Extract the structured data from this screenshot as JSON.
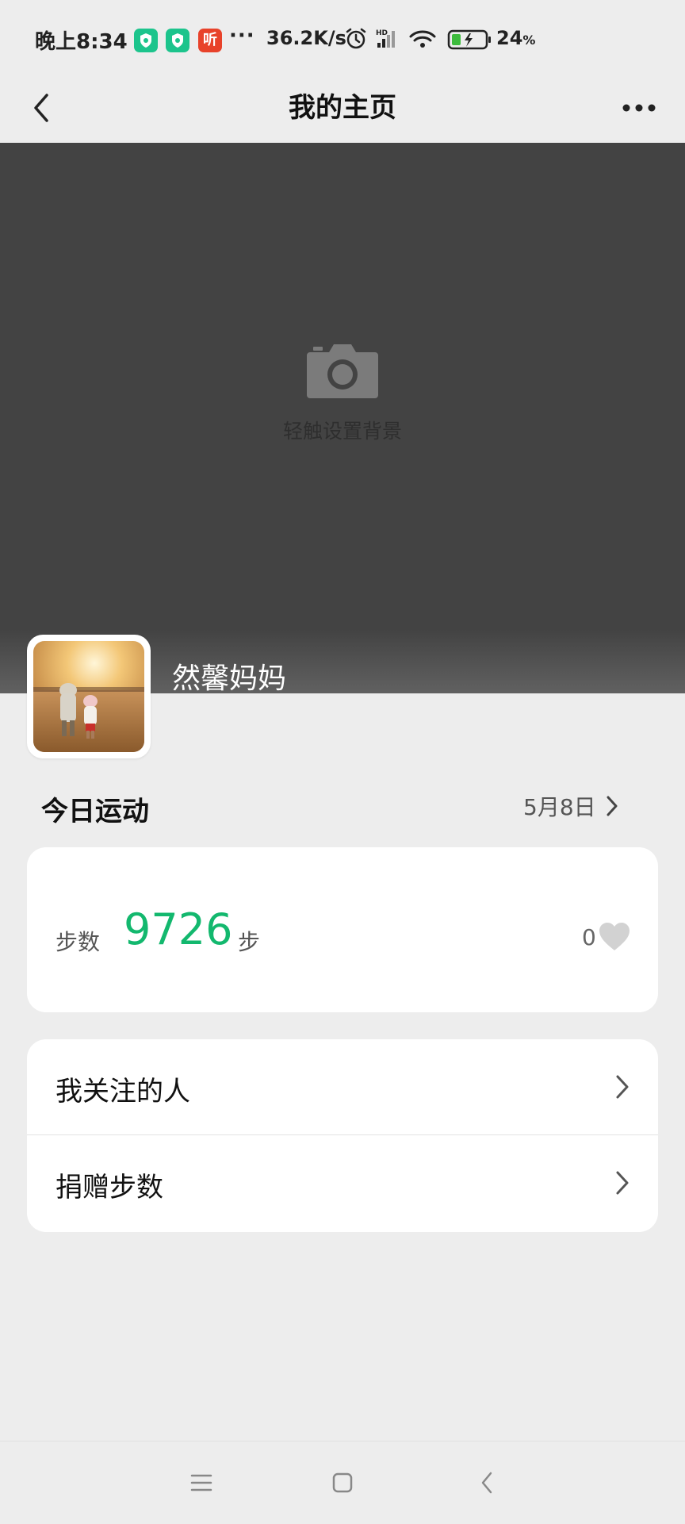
{
  "status_bar": {
    "time": "晚上8:34",
    "badge3_text": "听",
    "more": "···",
    "net_speed": "36.2K/s",
    "hd_label": "HD",
    "battery_percent": "24",
    "battery_unit": "%"
  },
  "nav": {
    "title": "我的主页"
  },
  "cover": {
    "set_background_label": "轻触设置背景"
  },
  "profile": {
    "nickname": "然馨妈妈"
  },
  "today": {
    "title": "今日运动",
    "date": "5月8日"
  },
  "steps": {
    "label": "步数",
    "value": "9726",
    "unit": "步",
    "likes": "0"
  },
  "menu": {
    "items": [
      {
        "label": "我关注的人"
      },
      {
        "label": "捐赠步数"
      }
    ]
  },
  "colors": {
    "accent_green": "#13b86e",
    "cover_bg": "#434343",
    "page_bg": "#ededed"
  },
  "icons": {
    "back": "chevron-left-icon",
    "more": "more-horizontal-icon",
    "camera": "camera-icon",
    "heart": "heart-icon",
    "chevron": "chevron-right-icon"
  }
}
